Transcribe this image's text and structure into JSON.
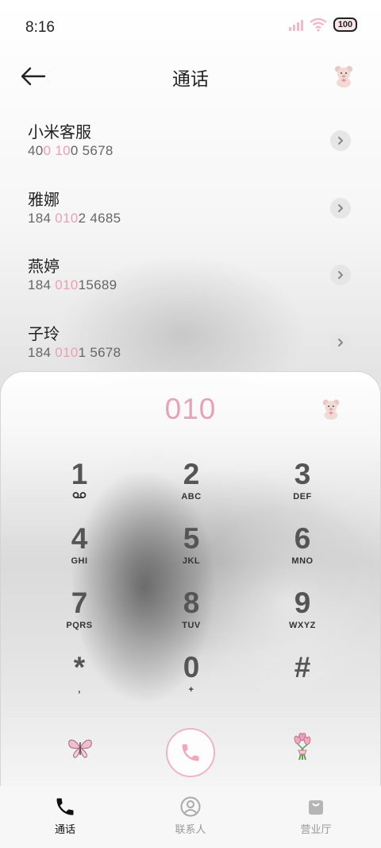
{
  "status": {
    "time": "8:16",
    "battery": "100"
  },
  "header": {
    "title": "通话"
  },
  "results": [
    {
      "name": "小米客服",
      "num_pre": "40",
      "num_hl1": "0",
      "num_mid": " ",
      "num_hl2": "10",
      "num_post": "0 5678"
    },
    {
      "name": "雅娜",
      "num_pre": "184 ",
      "num_hl1": "010",
      "num_mid": "",
      "num_hl2": "",
      "num_post": "2 4685"
    },
    {
      "name": "燕婷",
      "num_pre": "184 ",
      "num_hl1": "010",
      "num_mid": "",
      "num_hl2": "",
      "num_post": "15689"
    },
    {
      "name": "子玲",
      "num_pre": "184 ",
      "num_hl1": "010",
      "num_mid": "",
      "num_hl2": "",
      "num_post": "1 5678"
    }
  ],
  "dialer": {
    "input": "010",
    "keys": [
      {
        "digit": "1",
        "sub": "voicemail"
      },
      {
        "digit": "2",
        "sub": "ABC"
      },
      {
        "digit": "3",
        "sub": "DEF"
      },
      {
        "digit": "4",
        "sub": "GHI"
      },
      {
        "digit": "5",
        "sub": "JKL"
      },
      {
        "digit": "6",
        "sub": "MNO"
      },
      {
        "digit": "7",
        "sub": "PQRS"
      },
      {
        "digit": "8",
        "sub": "TUV"
      },
      {
        "digit": "9",
        "sub": "WXYZ"
      },
      {
        "digit": "*",
        "sub": ","
      },
      {
        "digit": "0",
        "sub": "+"
      },
      {
        "digit": "#",
        "sub": ""
      }
    ]
  },
  "nav": [
    {
      "label": "通话",
      "icon": "phone-icon",
      "active": true
    },
    {
      "label": "联系人",
      "icon": "contact-icon",
      "active": false
    },
    {
      "label": "营业厅",
      "icon": "bag-icon",
      "active": false
    }
  ],
  "colors": {
    "accent": "#e8a2b4",
    "call_border": "#f0b4c4"
  }
}
